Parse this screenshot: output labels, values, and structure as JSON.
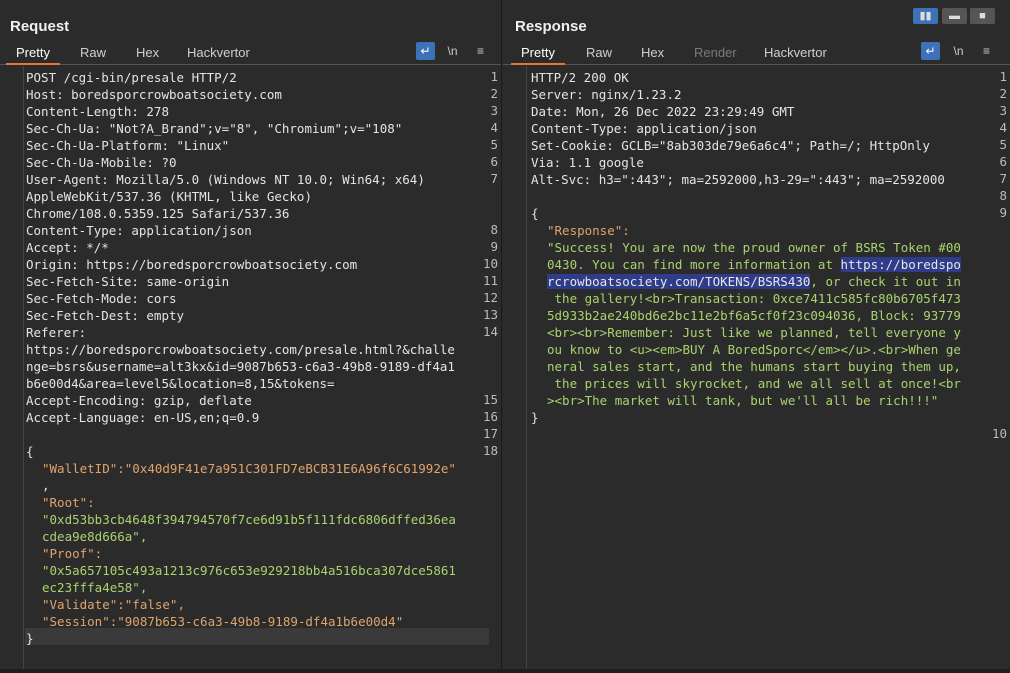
{
  "request": {
    "title": "Request",
    "tabs": [
      "Pretty",
      "Raw",
      "Hex",
      "Hackvertor"
    ],
    "line_numbers": [
      "1",
      "2",
      "3",
      "4",
      "5",
      "6",
      "7",
      "8",
      "9",
      "10",
      "11",
      "12",
      "13",
      "14",
      "15",
      "16",
      "17",
      "18"
    ],
    "lines": [
      "POST /cgi-bin/presale HTTP/2",
      "Host: boredsporcrowboatsociety.com",
      "Content-Length: 278",
      "Sec-Ch-Ua: \"Not?A_Brand\";v=\"8\", \"Chromium\";v=\"108\"",
      "Sec-Ch-Ua-Platform: \"Linux\"",
      "Sec-Ch-Ua-Mobile: ?0",
      "User-Agent: Mozilla/5.0 (Windows NT 10.0; Win64; x64)",
      "AppleWebKit/537.36 (KHTML, like Gecko)",
      "Chrome/108.0.5359.125 Safari/537.36",
      "Content-Type: application/json",
      "Accept: */*",
      "Origin: https://boredsporcrowboatsociety.com",
      "Sec-Fetch-Site: same-origin",
      "Sec-Fetch-Mode: cors",
      "Sec-Fetch-Dest: empty",
      "Referer:",
      "https://boredsporcrowboatsociety.com/presale.html?&challe",
      "nge=bsrs&username=alt3kx&id=9087b653-c6a3-49b8-9189-df4a1",
      "b6e00d4&area=level5&location=8,15&tokens=",
      "Accept-Encoding: gzip, deflate",
      "Accept-Language: en-US,en;q=0.9",
      "",
      "{",
      "\"WalletID\":\"0x40d9F41e7a951C301FD7eBCB31E6A96f6C61992e\"",
      ",",
      "\"Root\":",
      "\"0xd53bb3cb4648f394794570f7ce6d91b5f111fdc6806dffed36ea",
      "cdea9e8d666a\",",
      "\"Proof\":",
      "\"0x5a657105c493a1213c976c653e929218bb4a516bca307dce5861",
      "ec23fffa4e58\",",
      "\"Validate\":\"false\",",
      "\"Session\":\"9087b653-c6a3-49b8-9189-df4a1b6e00d4\"",
      "}"
    ]
  },
  "response": {
    "title": "Response",
    "tabs": [
      "Pretty",
      "Raw",
      "Hex",
      "Render",
      "Hackvertor"
    ],
    "line_numbers": [
      "1",
      "2",
      "3",
      "4",
      "5",
      "6",
      "7",
      "8",
      "9",
      "10"
    ],
    "lines": [
      "HTTP/2 200 OK",
      "Server: nginx/1.23.2",
      "Date: Mon, 26 Dec 2022 23:29:49 GMT",
      "Content-Type: application/json",
      "Set-Cookie: GCLB=\"8ab303de79e6a6c4\"; Path=/; HttpOnly",
      "Via: 1.1 google",
      "Alt-Svc: h3=\":443\"; ma=2592000,h3-29=\":443\"; ma=2592000",
      "",
      "{",
      "\"Response\":",
      "\"Success! You are now the proud owner of BSRS Token #00",
      "0430. You can find more information at https://boredspo",
      "rcrowboatsociety.com/TOKENS/BSRS430, or check it out in",
      " the gallery!<br>Transaction: 0xce7411c585fc80b6705f473",
      "5d933b2ae240bd6e2bc11e2bf6a5cf0f23c094036, Block: 93779",
      "<br><br>Remember: Just like we planned, tell everyone y",
      "ou know to <u><em>BUY A BoredSporc</em></u>.<br>When ge",
      "neral sales start, and the humans start buying them up,",
      " the prices will skyrocket, and we all sell at once!<br",
      "><br>The market will tank, but we'll all be rich!!!\"",
      "}"
    ]
  },
  "toolbar_icons": {
    "wrap": "↵",
    "newline": "\\n",
    "menu": "≡"
  },
  "colors": {
    "accent": "#e8733a",
    "key": "#e0a46b",
    "string": "#a8d36e",
    "selection": "#2e3c8a",
    "button": "#3d72b8"
  }
}
